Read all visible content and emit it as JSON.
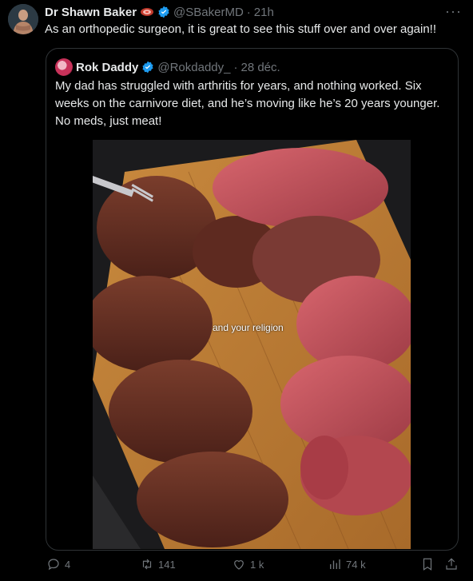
{
  "tweet": {
    "author_name": "Dr Shawn Baker",
    "author_handle": "@SBakerMD",
    "separator": "·",
    "time": "21h",
    "text": "As an orthopedic surgeon, it is great to see this stuff over and over again!!",
    "more_label": "···"
  },
  "quoted": {
    "author_name": "Rok Daddy",
    "author_handle": "@Rokdaddy_",
    "separator": "·",
    "date": "28 déc.",
    "text": "My dad has struggled with arthritis for years, and nothing worked. Six weeks on the carnivore diet, and he’s moving like he’s 20 years younger. No meds, just meat!",
    "media_caption": "and your religion"
  },
  "actions": {
    "replies": "4",
    "reposts": "141",
    "likes": "1 k",
    "views": "74 k"
  },
  "colors": {
    "verified": "#1d9bf0",
    "muted": "#71767b",
    "border": "#2f3336"
  }
}
